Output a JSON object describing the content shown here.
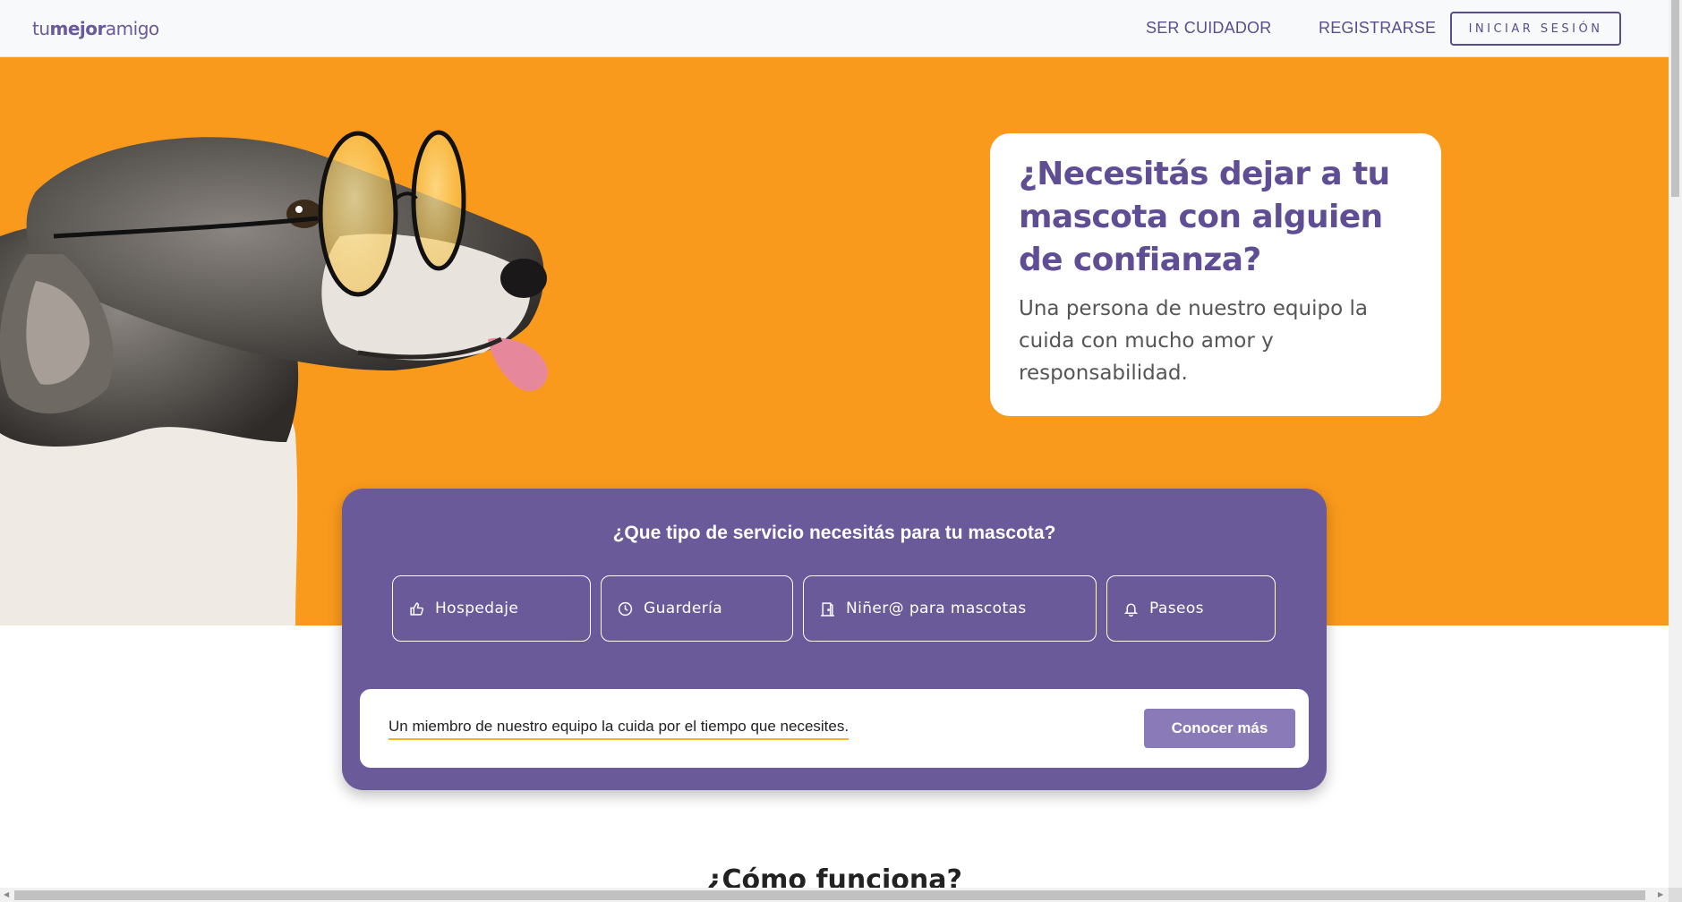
{
  "header": {
    "logo_light_1": "tu",
    "logo_bold": "mejor",
    "logo_light_2": "amigo",
    "nav": {
      "ser_cuidador": "SER CUIDADOR",
      "registrarse": "REGISTRARSE",
      "iniciar_sesion": "INICIAR SESIÓN"
    }
  },
  "hero": {
    "title": "¿Necesitás dejar a tu mascota con alguien de confianza?",
    "subtitle": "Una persona de nuestro equipo la cuida con mucho amor y responsabilidad.",
    "background_color": "#f99a1c"
  },
  "services": {
    "question": "¿Que tipo de servicio necesitás para tu mascota?",
    "items": [
      {
        "label": "Hospedaje",
        "icon": "thumbs-up-icon"
      },
      {
        "label": "Guardería",
        "icon": "clock-icon"
      },
      {
        "label": "Niñer@ para mascotas",
        "icon": "door-icon"
      },
      {
        "label": "Paseos",
        "icon": "bell-icon"
      }
    ],
    "panel_color": "#6a5a99",
    "info_text": "Un miembro de nuestro equipo la cuida por el tiempo que necesites.",
    "more_button": "Conocer más"
  },
  "how_it_works": {
    "title": "¿Cómo funciona?"
  }
}
